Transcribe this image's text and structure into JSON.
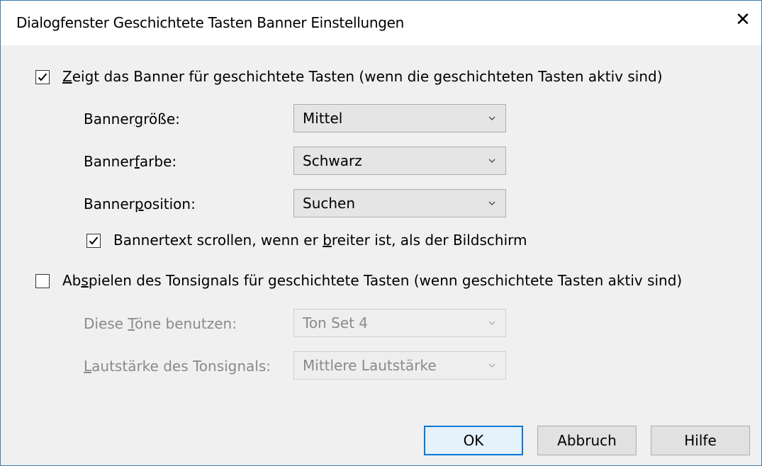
{
  "window": {
    "title": "Dialogfenster Geschichtete Tasten Banner Einstellungen",
    "close_glyph": "✕"
  },
  "banner": {
    "show_checked": true,
    "show_pre": "",
    "show_key": "Z",
    "show_post": "eigt das Banner für geschichtete Tasten (wenn die geschichteten Tasten aktiv sind)",
    "size_pre": "Banner",
    "size_key": "g",
    "size_post": "röße:",
    "size_value": "Mittel",
    "color_pre": "Banner",
    "color_key": "f",
    "color_post": "arbe:",
    "color_value": "Schwarz",
    "position_pre": "Banner",
    "position_key": "p",
    "position_post": "osition:",
    "position_value": "Suchen",
    "scroll_checked": true,
    "scroll_pre": "Bannertext scrollen, wenn er ",
    "scroll_key": "b",
    "scroll_post": "reiter ist, als der Bildschirm"
  },
  "sound": {
    "play_checked": false,
    "play_pre": "Ab",
    "play_key": "s",
    "play_post": "pielen des Tonsignals für geschichtete Tasten (wenn geschichtete Tasten aktiv sind)",
    "tones_pre": "Diese ",
    "tones_key": "T",
    "tones_post": "öne benutzen:",
    "tones_value": "Ton Set 4",
    "volume_pre": "",
    "volume_key": "L",
    "volume_post": "autstärke des Tonsignals:",
    "volume_value": "Mittlere Lautstärke"
  },
  "buttons": {
    "ok": "OK",
    "cancel": "Abbruch",
    "help": "Hilfe"
  },
  "colors": {
    "accent": "#0078d7",
    "window_border": "#3c7fb1",
    "disabled_text": "#8a8a8a"
  }
}
